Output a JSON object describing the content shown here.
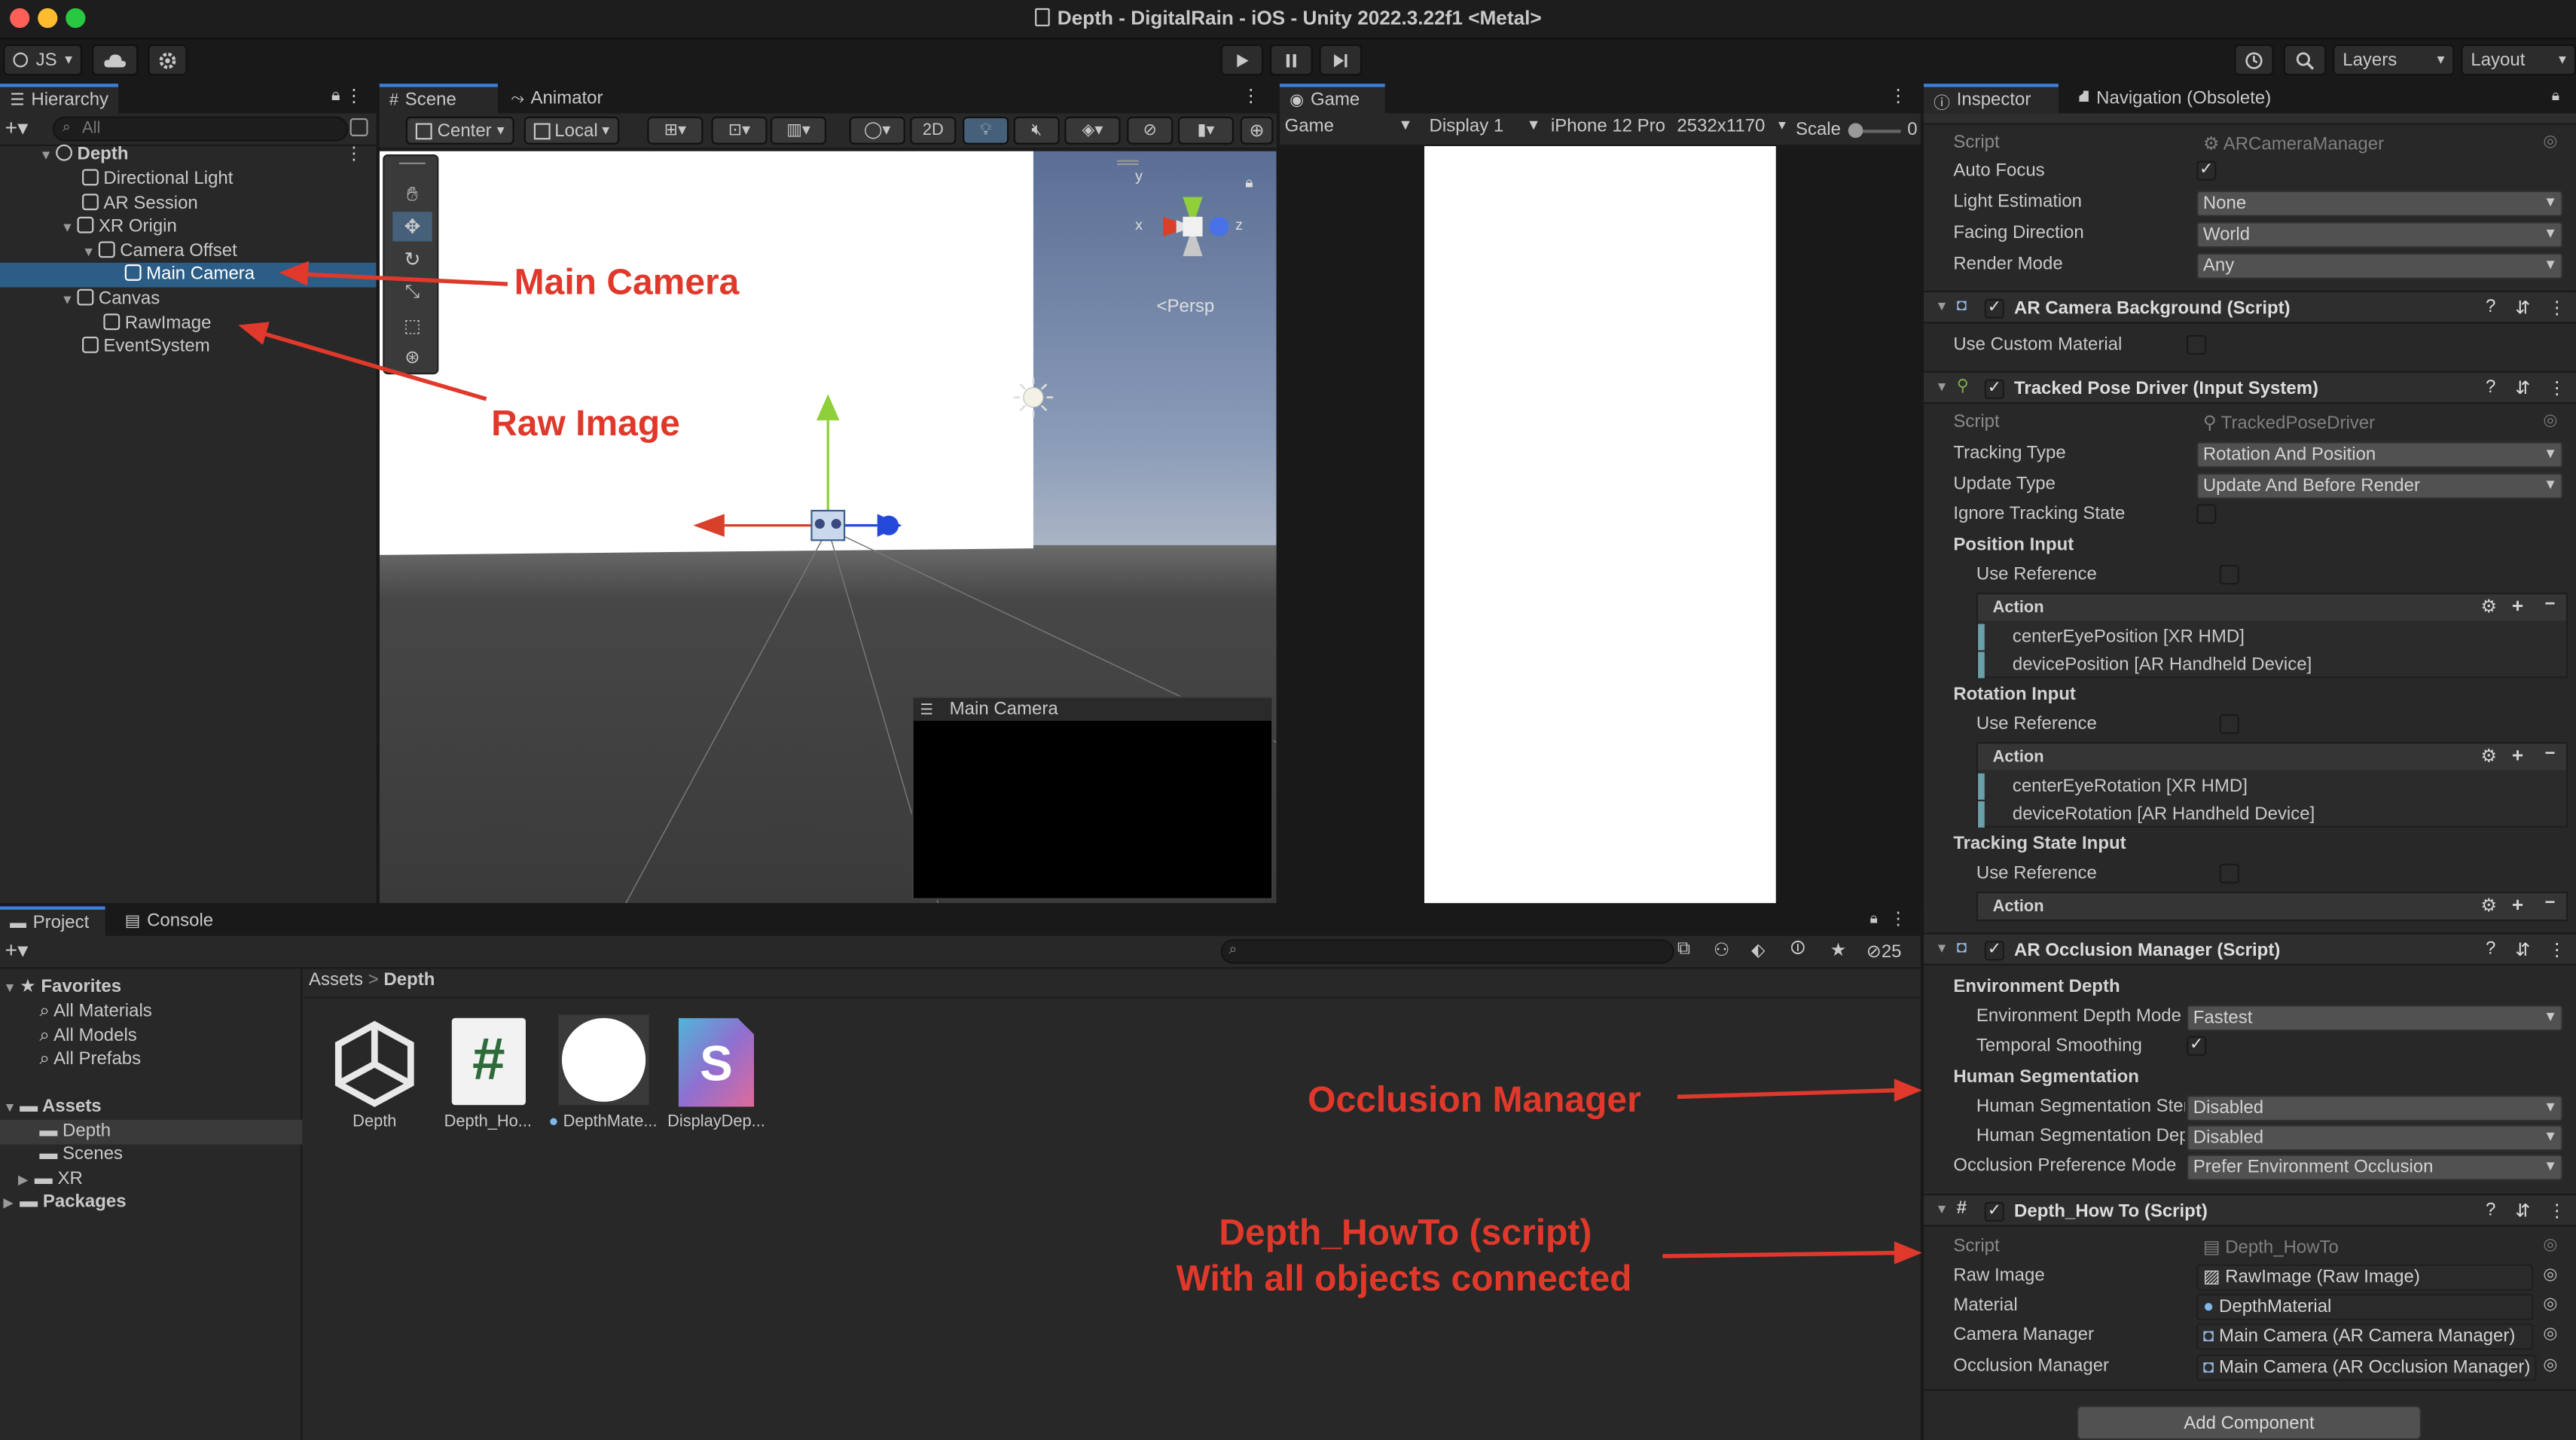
{
  "window": {
    "title": "Depth - DigitalRain - iOS - Unity 2022.3.22f1 <Metal>"
  },
  "toolbar": {
    "account": "JS",
    "layers": "Layers",
    "layout": "Layout"
  },
  "hierarchy": {
    "tab": "Hierarchy",
    "search_placeholder": "All",
    "items": [
      {
        "label": "Depth"
      },
      {
        "label": "Directional Light"
      },
      {
        "label": "AR Session"
      },
      {
        "label": "XR Origin"
      },
      {
        "label": "Camera Offset"
      },
      {
        "label": "Main Camera"
      },
      {
        "label": "Canvas"
      },
      {
        "label": "RawImage"
      },
      {
        "label": "EventSystem"
      }
    ]
  },
  "scene": {
    "tabs": [
      {
        "label": "Scene"
      },
      {
        "label": "Animator"
      }
    ],
    "pivot": "Center",
    "space": "Local",
    "mode2d": "2D",
    "persp": "Persp",
    "axis_x": "x",
    "axis_y": "y",
    "axis_z": "z",
    "camera_preview": "Main Camera"
  },
  "game": {
    "tab": "Game",
    "mode": "Game",
    "display": "Display 1",
    "device": "iPhone 12 Pro",
    "resolution": "2532x1170",
    "scale_label": "Scale",
    "scale_value": "0"
  },
  "inspector": {
    "tabs": [
      {
        "label": "Inspector"
      },
      {
        "label": "Navigation (Obsolete)"
      }
    ],
    "ar_camera_manager": {
      "script_label": "Script",
      "script_value": "ARCameraManager",
      "auto_focus_label": "Auto Focus",
      "light_estimation_label": "Light Estimation",
      "light_estimation_value": "None",
      "facing_direction_label": "Facing Direction",
      "facing_direction_value": "World",
      "render_mode_label": "Render Mode",
      "render_mode_value": "Any"
    },
    "ar_camera_background": {
      "title": "AR Camera Background (Script)",
      "use_custom_material_label": "Use Custom Material"
    },
    "tracked_pose_driver": {
      "title": "Tracked Pose Driver (Input System)",
      "script_label": "Script",
      "script_value": "TrackedPoseDriver",
      "tracking_type_label": "Tracking Type",
      "tracking_type_value": "Rotation And Position",
      "update_type_label": "Update Type",
      "update_type_value": "Update And Before Render",
      "ignore_tracking_state_label": "Ignore Tracking State",
      "position_input_label": "Position Input",
      "position_use_reference_label": "Use Reference",
      "position_action_label": "Action",
      "position_bindings": [
        "centerEyePosition [XR HMD]",
        "devicePosition [AR Handheld Device]"
      ],
      "rotation_input_label": "Rotation Input",
      "rotation_use_reference_label": "Use Reference",
      "rotation_action_label": "Action",
      "rotation_bindings": [
        "centerEyeRotation [XR HMD]",
        "deviceRotation [AR Handheld Device]"
      ],
      "tracking_state_input_label": "Tracking State Input",
      "tracking_use_reference_label": "Use Reference",
      "tracking_action_label": "Action"
    },
    "ar_occlusion_manager": {
      "title": "AR Occlusion Manager (Script)",
      "environment_depth_label": "Environment Depth",
      "env_depth_mode_label": "Environment Depth Mode",
      "env_depth_mode_value": "Fastest",
      "temporal_smoothing_label": "Temporal Smoothing",
      "human_segmentation_label": "Human Segmentation",
      "human_seg_stencil_label": "Human Segmentation Stencil Mode",
      "human_seg_stencil_value": "Disabled",
      "human_seg_depth_label": "Human Segmentation Depth Mode",
      "human_seg_depth_value": "Disabled",
      "occlusion_pref_label": "Occlusion Preference Mode",
      "occlusion_pref_value": "Prefer Environment Occlusion"
    },
    "depth_how_to": {
      "title": "Depth_How To (Script)",
      "script_label": "Script",
      "script_value": "Depth_HowTo",
      "raw_image_label": "Raw Image",
      "raw_image_value": "RawImage (Raw Image)",
      "material_label": "Material",
      "material_value": "DepthMaterial",
      "camera_manager_label": "Camera Manager",
      "camera_manager_value": "Main Camera (AR Camera Manager)",
      "occlusion_manager_label": "Occlusion Manager",
      "occlusion_manager_value": "Main Camera (AR Occlusion Manager)"
    },
    "add_component": "Add Component"
  },
  "project": {
    "tabs": [
      {
        "label": "Project"
      },
      {
        "label": "Console"
      }
    ],
    "hidden_count": "25",
    "breadcrumb_root": "Assets",
    "breadcrumb_leaf": "Depth",
    "tree": [
      {
        "label": "Favorites"
      },
      {
        "label": "All Materials"
      },
      {
        "label": "All Models"
      },
      {
        "label": "All Prefabs"
      },
      {
        "label": "Assets"
      },
      {
        "label": "Depth"
      },
      {
        "label": "Scenes"
      },
      {
        "label": "XR"
      },
      {
        "label": "Packages"
      }
    ],
    "assets": [
      {
        "label": "Depth"
      },
      {
        "label": "Depth_Ho..."
      },
      {
        "label": "DepthMate..."
      },
      {
        "label": "DisplayDep..."
      }
    ]
  },
  "annotations": {
    "main_camera": "Main Camera",
    "raw_image": "Raw Image",
    "occlusion_manager": "Occlusion  Manager",
    "depth_howto_line1": "Depth_HowTo (script)",
    "depth_howto_line2": "With all objects connected"
  },
  "colors": {
    "accent": "#3d7fdd",
    "selection": "#2c5d87",
    "annotation": "#e0392b"
  }
}
